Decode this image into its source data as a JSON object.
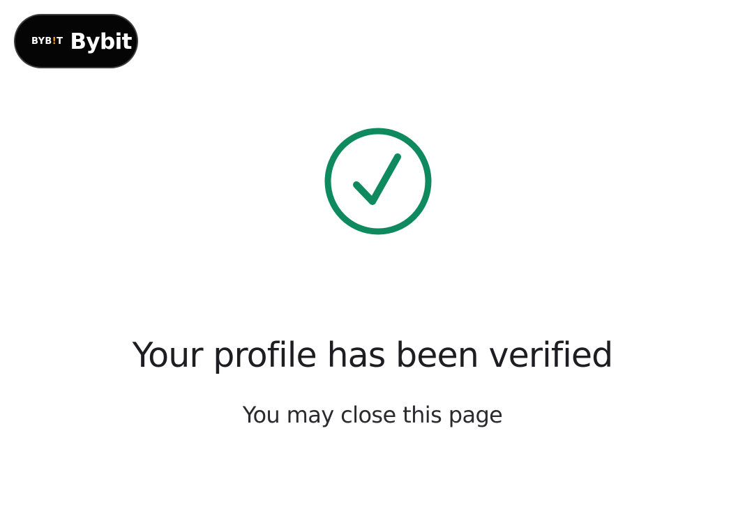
{
  "brand": {
    "mark_prefix": "BYB",
    "mark_accent": "!",
    "mark_suffix": "T",
    "name": "Bybit",
    "pill_color": "#050505",
    "accent_color": "#f7a600"
  },
  "status": {
    "icon": "check-circle-icon",
    "color": "#0f8a5f",
    "headline": "Your profile has been verified",
    "subtext": "You may close this page"
  }
}
